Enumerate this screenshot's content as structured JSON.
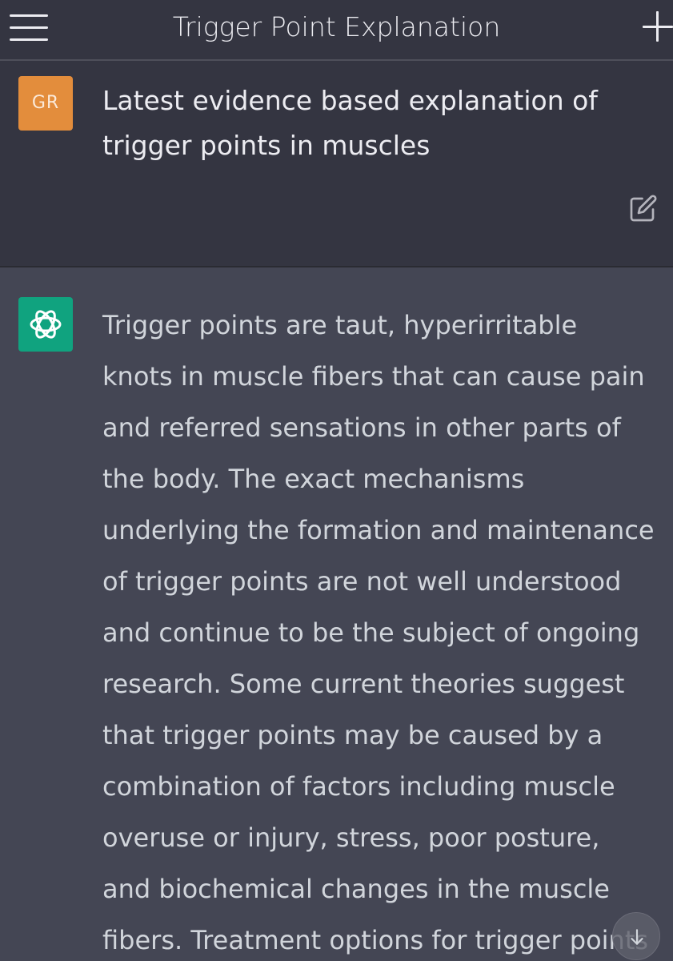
{
  "header": {
    "title": "Trigger Point Explanation"
  },
  "user_message": {
    "avatar_initials": "GR",
    "text": "Latest evidence based explanation of trigger points in muscles"
  },
  "assistant_message": {
    "lines": [
      "Trigger points are taut, hyperirritable",
      "knots in muscle fibers that can cause pain",
      "and referred sensations in other parts of",
      "the body. The exact mechanisms",
      "underlying the formation and maintenance",
      "of trigger points are not well understood",
      "and continue to be the subject of ongoing",
      "research. Some current theories suggest",
      "that trigger points may be caused by a",
      "combination of factors including muscle",
      "overuse or injury, stress, poor posture,",
      "and biochemical changes in the muscle",
      "fibers. Treatment options for trigger points"
    ]
  },
  "icons": {
    "menu": "hamburger-menu-icon",
    "new_chat": "plus-icon",
    "edit": "edit-icon",
    "assistant_avatar": "openai-logo-icon",
    "scroll_down": "arrow-down-icon"
  },
  "colors": {
    "header_bg": "#343541",
    "assistant_bg": "#444654",
    "user_avatar": "#e38d3c",
    "assistant_avatar": "#10a37f"
  }
}
